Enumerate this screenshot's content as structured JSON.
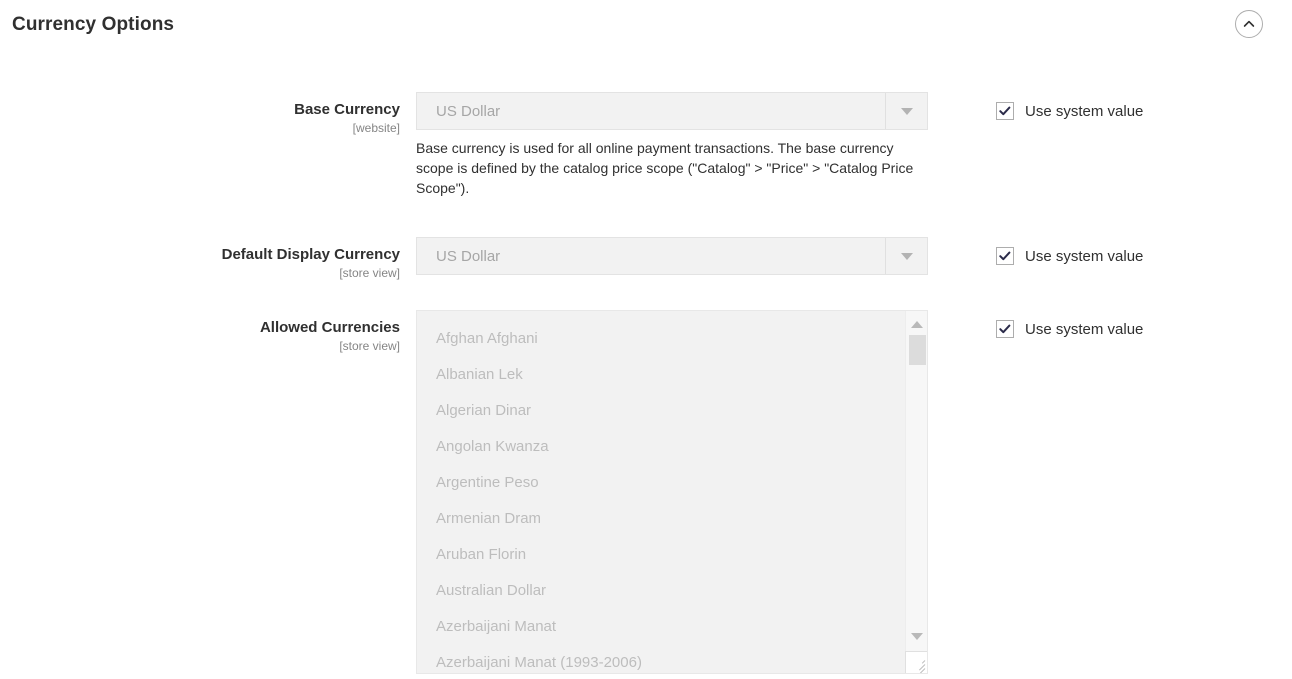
{
  "header": {
    "title": "Currency Options",
    "collapse_icon": "chevron-up-circle-icon"
  },
  "fields": [
    {
      "label": "Base Currency",
      "scope": "[website]",
      "type": "select",
      "value": "US Dollar",
      "dropdown_icon": "chevron-down-icon",
      "note": "Base currency is used for all online payment transactions. The base currency scope is defined by the catalog price scope (\"Catalog\" > \"Price\" > \"Catalog Price Scope\").",
      "use_system_value": {
        "label": "Use system value",
        "checked": true
      }
    },
    {
      "label": "Default Display Currency",
      "scope": "[store view]",
      "type": "select",
      "value": "US Dollar",
      "dropdown_icon": "chevron-down-icon",
      "note": "",
      "use_system_value": {
        "label": "Use system value",
        "checked": true
      }
    },
    {
      "label": "Allowed Currencies",
      "scope": "[store view]",
      "type": "multiselect",
      "options": [
        "Afghan Afghani",
        "Albanian Lek",
        "Algerian Dinar",
        "Angolan Kwanza",
        "Argentine Peso",
        "Armenian Dram",
        "Aruban Florin",
        "Australian Dollar",
        "Azerbaijani Manat",
        "Azerbaijani Manat (1993-2006)"
      ],
      "scroll_up_icon": "triangle-up-icon",
      "scroll_down_icon": "triangle-down-icon",
      "resize_icon": "resize-grip-icon",
      "use_system_value": {
        "label": "Use system value",
        "checked": true
      }
    }
  ],
  "colors": {
    "text": "#303030",
    "muted": "#858585",
    "disabled_text": "#a6a6a6",
    "list_text": "#bdbdbd",
    "field_bg": "#f2f2f2",
    "check": "#2b2b4a"
  }
}
